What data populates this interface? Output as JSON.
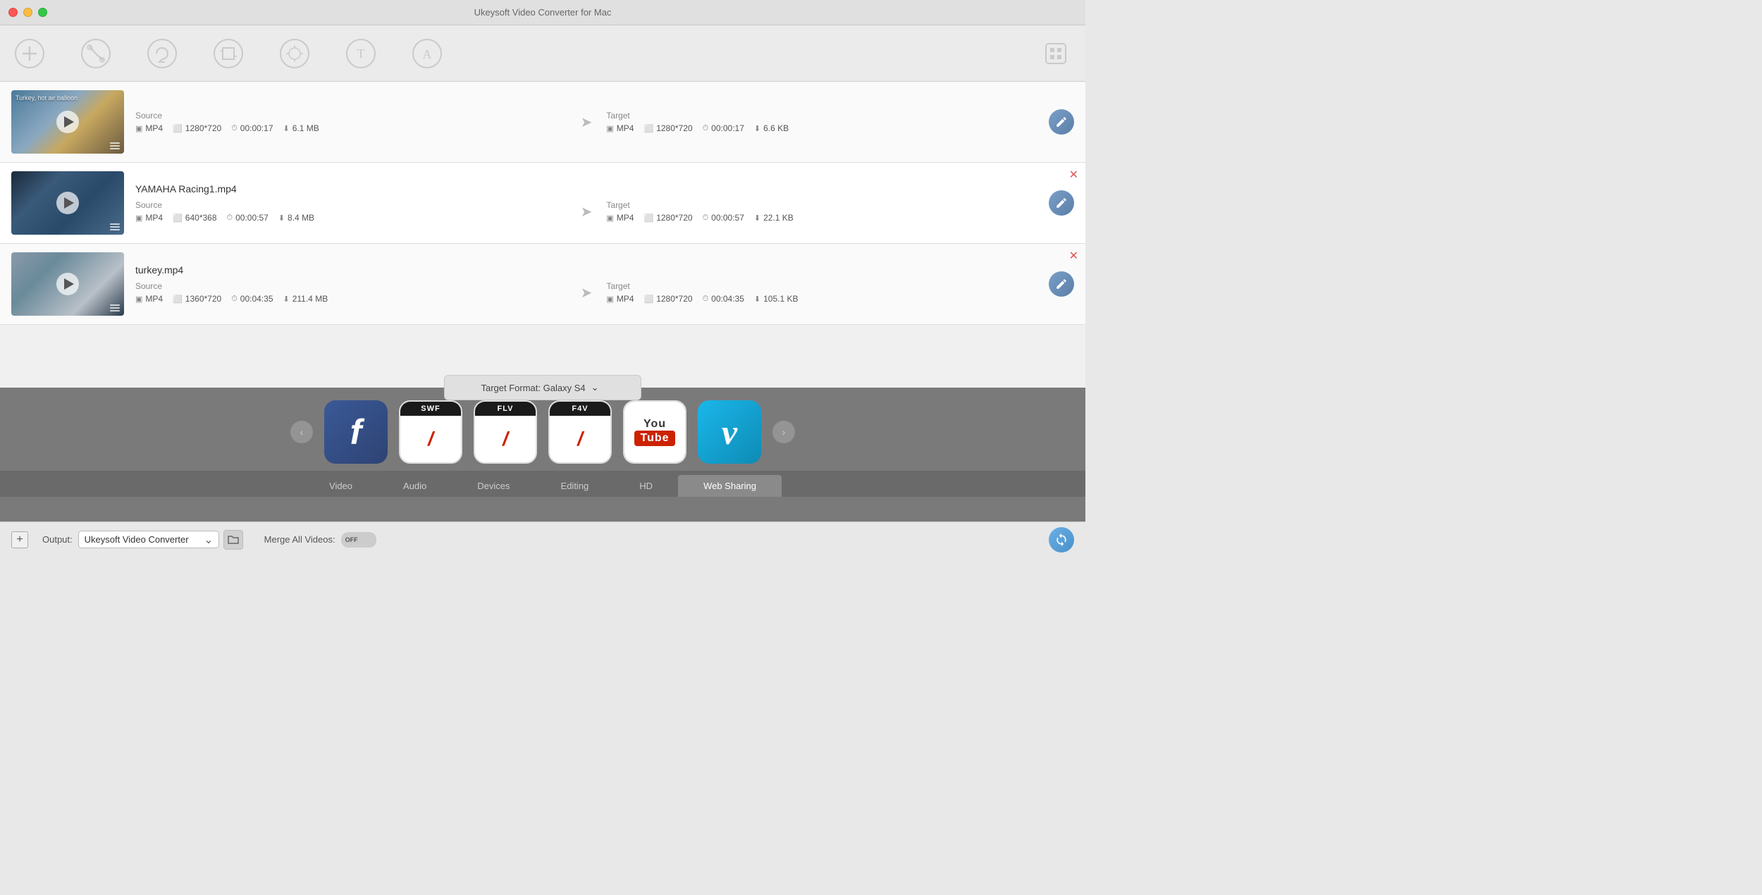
{
  "app": {
    "title": "Ukeysoft Video Converter for Mac"
  },
  "toolbar": {
    "icons": [
      {
        "name": "add-icon",
        "label": "Add"
      },
      {
        "name": "trim-icon",
        "label": "Trim"
      },
      {
        "name": "rotate-icon",
        "label": "Rotate"
      },
      {
        "name": "crop-icon",
        "label": "Crop"
      },
      {
        "name": "effect-icon",
        "label": "Effect"
      },
      {
        "name": "text-icon",
        "label": "Text"
      },
      {
        "name": "watermark-icon",
        "label": "Watermark"
      }
    ]
  },
  "videos": [
    {
      "id": 1,
      "name": "",
      "thumb_label": "Turkey, hot air balloon",
      "source_format": "MP4",
      "source_resolution": "1280*720",
      "source_duration": "00:00:17",
      "source_size": "6.1 MB",
      "target_format": "MP4",
      "target_resolution": "1280*720",
      "target_duration": "00:00:17",
      "target_size": "6.6 KB",
      "has_close": false
    },
    {
      "id": 2,
      "name": "YAMAHA Racing1.mp4",
      "thumb_label": "",
      "source_format": "MP4",
      "source_resolution": "640*368",
      "source_duration": "00:00:57",
      "source_size": "8.4 MB",
      "target_format": "MP4",
      "target_resolution": "1280*720",
      "target_duration": "00:00:57",
      "target_size": "22.1 KB",
      "has_close": true
    },
    {
      "id": 3,
      "name": "turkey.mp4",
      "thumb_label": "",
      "source_format": "MP4",
      "source_resolution": "1360*720",
      "source_duration": "00:04:35",
      "source_size": "211.4 MB",
      "target_format": "MP4",
      "target_resolution": "1280*720",
      "target_duration": "00:04:35",
      "target_size": "105.1 KB",
      "has_close": true
    }
  ],
  "source_label": "Source",
  "target_label": "Target",
  "format_selector": {
    "label": "Target Format: Galaxy S4"
  },
  "format_icons": [
    {
      "id": "facebook",
      "label": "Facebook"
    },
    {
      "id": "swf",
      "label": "SWF"
    },
    {
      "id": "flv",
      "label": "FLV"
    },
    {
      "id": "f4v",
      "label": "F4V"
    },
    {
      "id": "youtube",
      "label": "YouTube"
    },
    {
      "id": "vimeo",
      "label": "Vimeo"
    }
  ],
  "tabs": [
    {
      "id": "video",
      "label": "Video",
      "active": false
    },
    {
      "id": "audio",
      "label": "Audio",
      "active": false
    },
    {
      "id": "devices",
      "label": "Devices",
      "active": false
    },
    {
      "id": "editing",
      "label": "Editing",
      "active": false
    },
    {
      "id": "hd",
      "label": "HD",
      "active": false
    },
    {
      "id": "websharing",
      "label": "Web Sharing",
      "active": true
    }
  ],
  "bottom_bar": {
    "output_label": "Output:",
    "output_value": "Ukeysoft Video Converter",
    "merge_label": "Merge All Videos:",
    "toggle_state": "OFF"
  }
}
